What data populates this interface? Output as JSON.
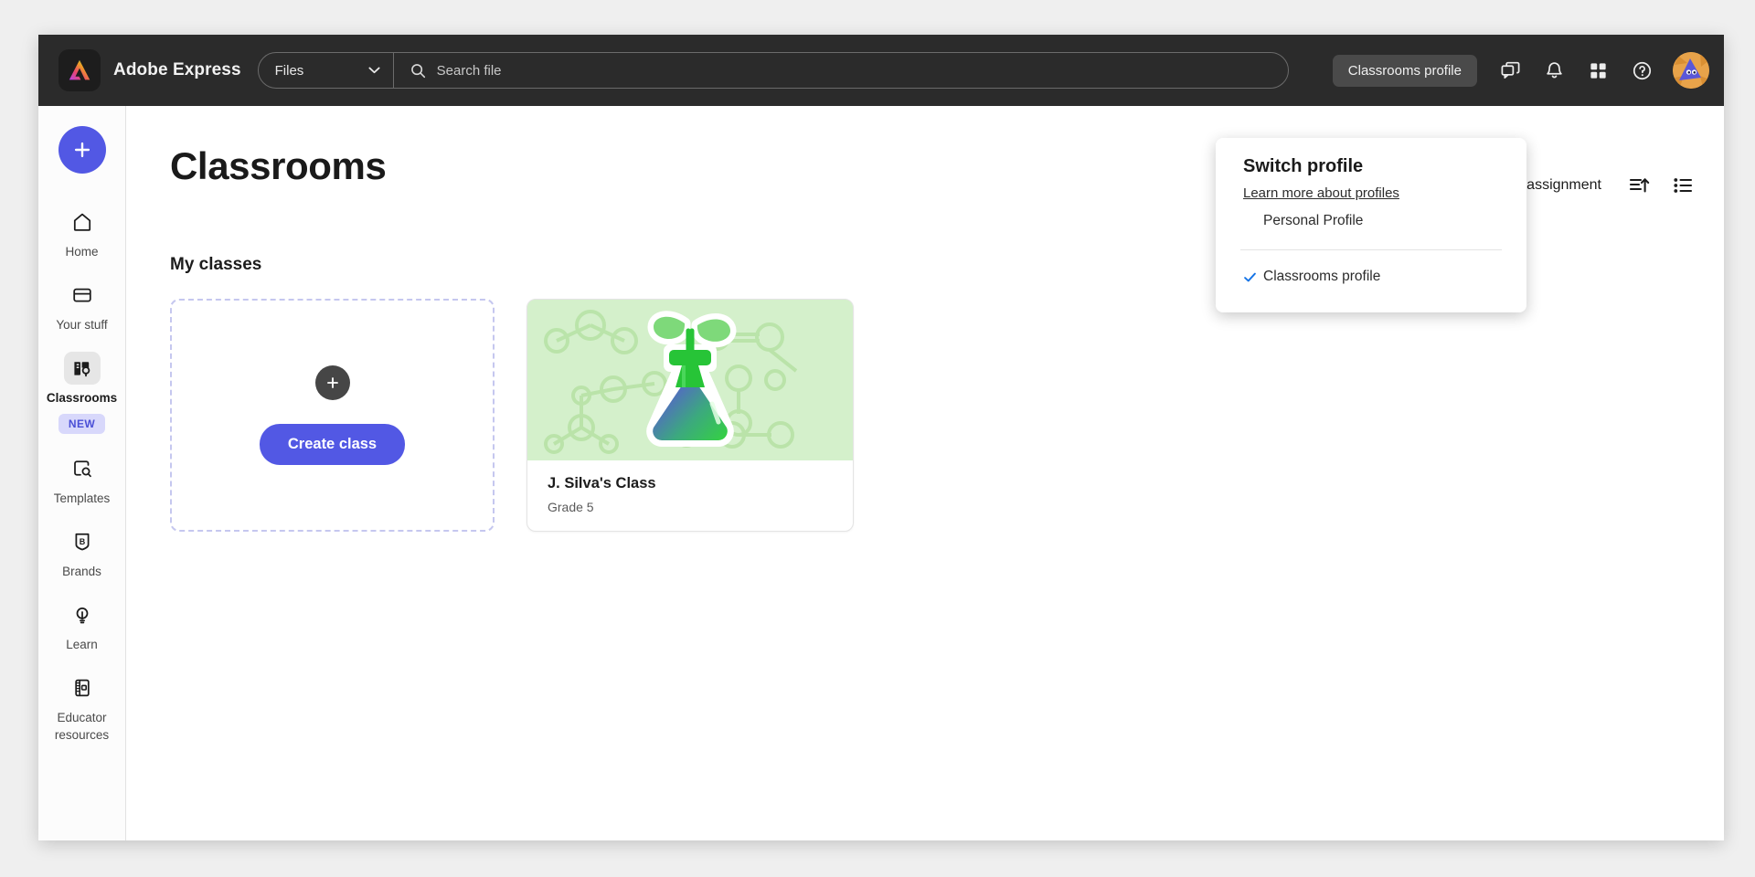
{
  "topbar": {
    "logo_icon": "adobe-express-logo-icon",
    "brand": "Adobe Express",
    "scope_select": {
      "value": "Files",
      "icon": "chevron-down-icon"
    },
    "search": {
      "placeholder": "Search file",
      "icon": "search-icon"
    },
    "profile_pill": "Classrooms profile",
    "icons": [
      {
        "name": "chat-bubbles-icon",
        "label": "Feedback"
      },
      {
        "name": "bell-icon",
        "label": "Notifications"
      },
      {
        "name": "apps-grid-icon",
        "label": "Apps"
      },
      {
        "name": "help-circle-icon",
        "label": "Help"
      }
    ],
    "avatar": {
      "name": "user-avatar",
      "bg_color": "#e8a34a",
      "fg_color": "#5a57d8"
    }
  },
  "sidebar": {
    "create_button": {
      "icon": "plus-icon",
      "accent": "#5258e4"
    },
    "items": [
      {
        "label": "Home",
        "icon": "home-icon",
        "active": false
      },
      {
        "label": "Your stuff",
        "icon": "folder-icon",
        "active": false
      },
      {
        "label": "Classrooms",
        "icon": "classrooms-icon",
        "active": true,
        "badge": "NEW"
      },
      {
        "label": "Templates",
        "icon": "templates-search-icon",
        "active": false
      },
      {
        "label": "Brands",
        "icon": "brand-shield-icon",
        "active": false
      },
      {
        "label": "Learn",
        "icon": "lightbulb-icon",
        "active": false
      },
      {
        "label": "Educator resources",
        "icon": "notebook-icon",
        "active": false
      }
    ]
  },
  "main": {
    "page_title": "Classrooms",
    "toolbar": {
      "create_assignment": "Create assignment",
      "sort_icon": "sort-ascending-icon",
      "view_icon": "list-view-icon"
    },
    "section_title": "My classes",
    "create_class_card": {
      "plus_icon": "plus-icon",
      "button_label": "Create class"
    },
    "classes": [
      {
        "name": "J. Silva's Class",
        "grade": "Grade 5",
        "thumb_icon": "science-flask-plant-icon",
        "thumb_bg": "#d4f0cb"
      }
    ]
  },
  "popover": {
    "title": "Switch profile",
    "link": "Learn more about profiles",
    "options": [
      {
        "label": "Personal Profile",
        "selected": false
      },
      {
        "label": "Classrooms profile",
        "selected": true
      }
    ],
    "check_color": "#1473e6"
  }
}
